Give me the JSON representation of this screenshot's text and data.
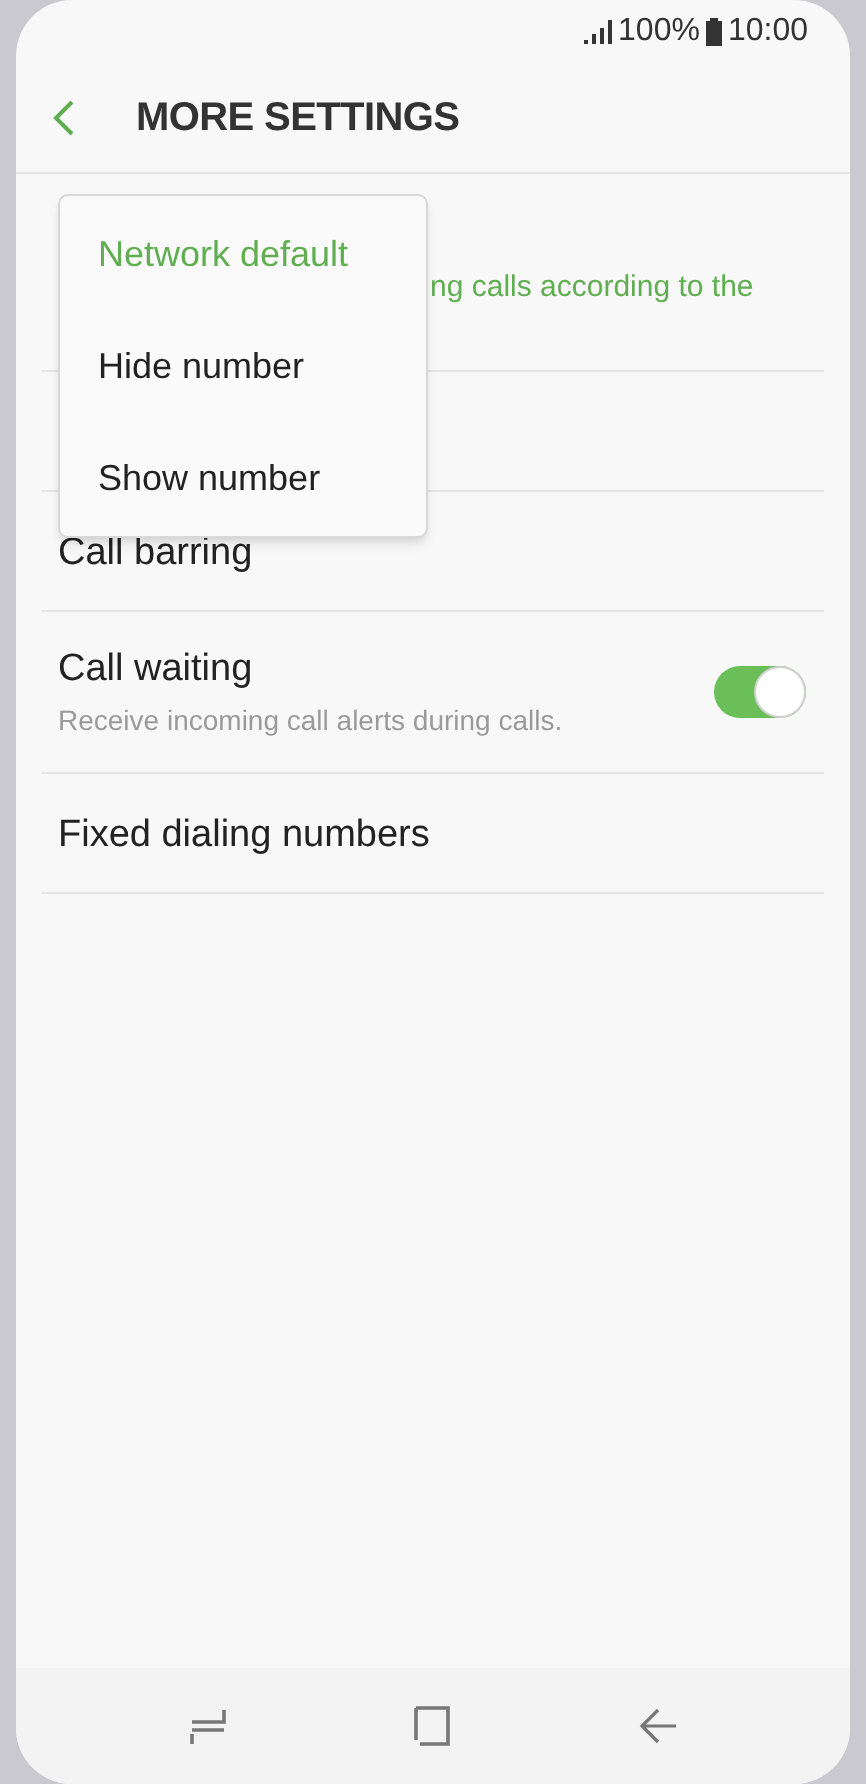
{
  "status_bar": {
    "battery": "100%",
    "time": "10:00"
  },
  "header": {
    "title": "MORE SETTINGS"
  },
  "settings": [
    {
      "kind": "hidden",
      "subtitle_fragment": "ng calls according to the"
    },
    {
      "kind": "covered"
    },
    {
      "kind": "plain",
      "title": "Call barring"
    },
    {
      "kind": "toggle",
      "title": "Call waiting",
      "subtitle": "Receive incoming call alerts during calls.",
      "on": true
    },
    {
      "kind": "plain",
      "title": "Fixed dialing numbers"
    }
  ],
  "menu": [
    {
      "label": "Network default",
      "selected": true
    },
    {
      "label": "Hide number",
      "selected": false
    },
    {
      "label": "Show number",
      "selected": false
    }
  ]
}
